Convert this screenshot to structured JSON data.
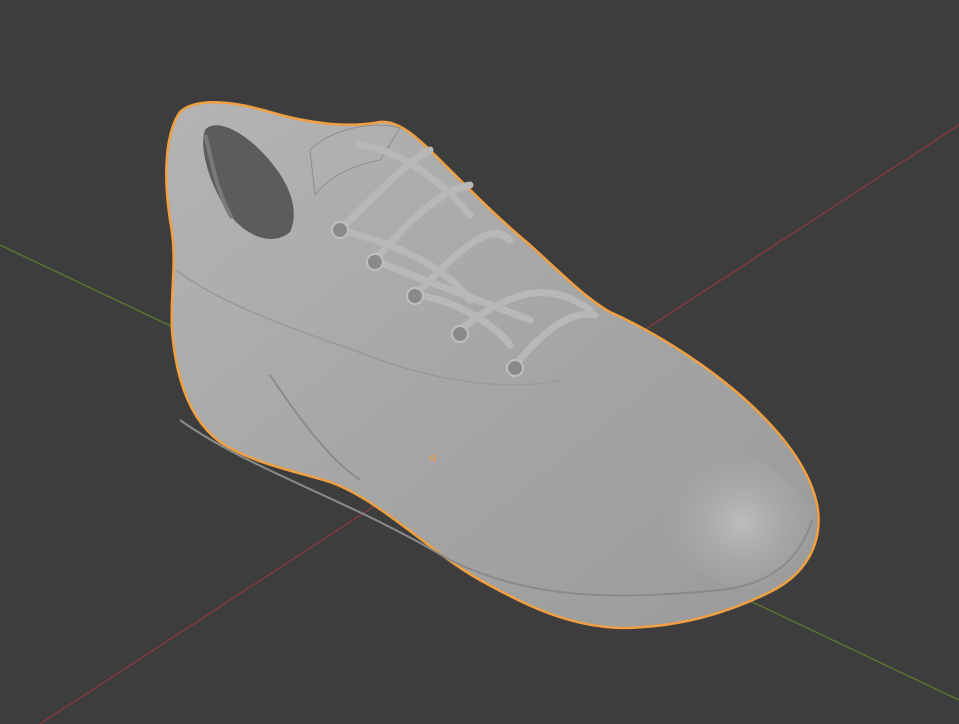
{
  "viewport": {
    "background_color": "#3d3d3d",
    "x_axis_color": "#8a3a3e",
    "y_axis_color": "#5a7a2e",
    "selection_outline_color": "#f0a040",
    "object_color": "#a8a8a8",
    "object_name_icon": "shoe-mesh",
    "origin_icon": "object-origin-dot"
  }
}
